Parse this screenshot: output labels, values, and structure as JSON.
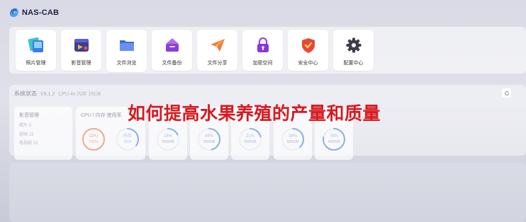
{
  "brand": {
    "name": "NAS-CAB"
  },
  "apps": [
    {
      "label": "照片管理",
      "icon": "photos-icon"
    },
    {
      "label": "影音管理",
      "icon": "media-icon"
    },
    {
      "label": "文件浏览",
      "icon": "folder-icon"
    },
    {
      "label": "文件备份",
      "icon": "backup-icon"
    },
    {
      "label": "文件分享",
      "icon": "share-icon"
    },
    {
      "label": "加密空间",
      "icon": "lock-icon"
    },
    {
      "label": "安全中心",
      "icon": "shield-icon"
    },
    {
      "label": "配置中心",
      "icon": "gear-icon"
    }
  ],
  "status": {
    "title": "系统状态",
    "version": "V3.1.2",
    "cpu_info": "CPU 4x 内存 15GB",
    "refresh_icon": "refresh-icon"
  },
  "media": {
    "title": "影音管理",
    "rows": [
      "照片 0",
      "视频 23",
      "电视剧 23"
    ]
  },
  "usage": {
    "title": "CPU / 内存 使用率",
    "cpu": {
      "label": "CPU",
      "value": "100%",
      "percent": 100,
      "color": "#f0a98d"
    },
    "mem": {
      "label": "内存",
      "value": "35%",
      "percent": 35,
      "color": "#8ab0e6"
    }
  },
  "disks": [
    {
      "percent_text": "18%",
      "size": "500GB",
      "percent": 18
    },
    {
      "percent_text": "46%",
      "size": "250GB",
      "percent": 46
    },
    {
      "percent_text": "21%",
      "size": "500GB",
      "percent": 21
    },
    {
      "percent_text": "38%",
      "size": "500GB",
      "percent": 38
    },
    {
      "percent_text": "78%",
      "size": "500GB",
      "percent": 78
    }
  ],
  "headline": "如何提高水果养殖的产量和质量",
  "colors": {
    "accent": "#3b7bd9",
    "headline": "#d8191f",
    "ring_blue": "#8ab0e6",
    "ring_orange": "#f0a98d"
  }
}
